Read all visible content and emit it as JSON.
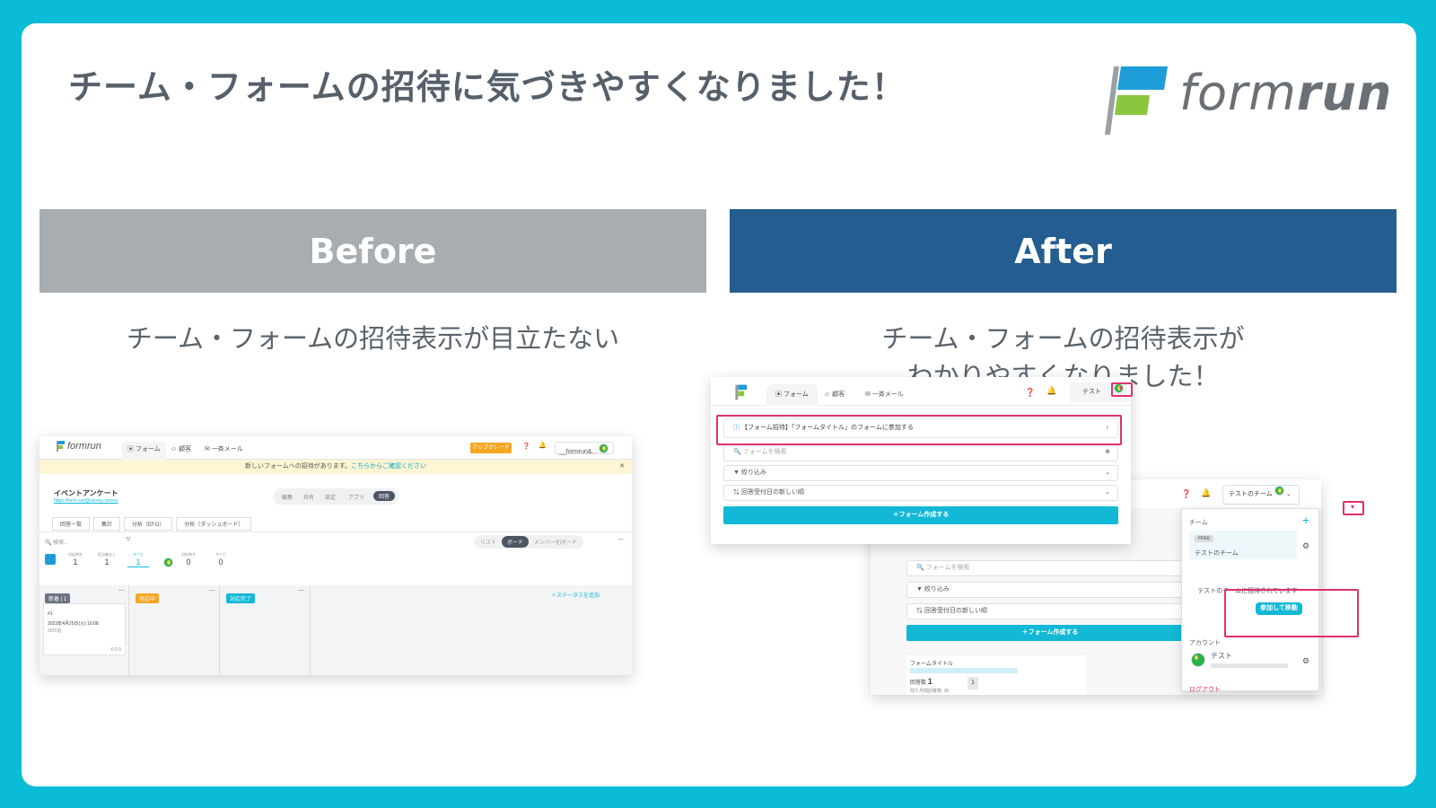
{
  "headline": "チーム・フォームの招待に気づきやすくなりました！",
  "brand": {
    "word_plain": "form",
    "word_bold": "run"
  },
  "before": {
    "banner": "Before",
    "caption": "チーム・フォームの招待表示が目立たない",
    "screenshot": {
      "logo": "formrun",
      "tabs": [
        "フォーム",
        "顧客",
        "一斉メール"
      ],
      "upgrade": "アップグレード",
      "account": "__formrun&...",
      "notice_text": "新しいフォームへの招待があります。",
      "notice_link": "こちらからご確認ください",
      "form_title": "イベントアンケート",
      "form_link": "https://form.run/@survey-xxxxxx",
      "segments": [
        "編集",
        "共有",
        "設定",
        "アプリ",
        "回答"
      ],
      "subtabs": [
        "回答一覧",
        "集計",
        "分析（EFO）",
        "分析（ダッシュボード）"
      ],
      "search_placeholder": "検索...",
      "view_toggle": [
        "リスト",
        "ボード",
        "メンバー別ボード"
      ],
      "counters": [
        {
          "label": "対応待ち",
          "value": "1"
        },
        {
          "label": "担当者なし",
          "value": "1"
        },
        {
          "label": "すべて",
          "value": "1"
        },
        {
          "label": "対応待ち",
          "value": "0"
        },
        {
          "label": "すべて",
          "value": "0"
        }
      ],
      "columns": [
        {
          "label": "新着",
          "count": "1",
          "color": "#6b7280"
        },
        {
          "label": "対応中",
          "count": "",
          "color": "#f5a623"
        },
        {
          "label": "対応完了",
          "count": "",
          "color": "#12b8d6"
        }
      ],
      "add_status": "＋ステータスを追加",
      "card": {
        "id": "#1",
        "date": "2023年4月25日(火) 16:08",
        "ago": "30日前",
        "meta": "0  0  0"
      }
    }
  },
  "after": {
    "banner": "After",
    "caption_line1": "チーム・フォームの招待表示が",
    "caption_line2": "わかりやすくなりました！",
    "top_window": {
      "tabs": [
        "フォーム",
        "顧客",
        "一斉メール"
      ],
      "account": "テスト",
      "invite_banner": "【フォーム招待】「フォームタイトル」のフォームに参加する",
      "search_placeholder": "フォームを検索",
      "filter": "絞り込み",
      "sort": "回答受付日の新しい順",
      "create": "＋フォーム作成する"
    },
    "back_window": {
      "account": "テストのチーム",
      "search_placeholder": "フォームを検索",
      "filter": "絞り込み",
      "sort": "回答受付日の新しい順",
      "create": "＋フォーム作成する",
      "form_label": "フォームタイトル",
      "responses_label": "回答数",
      "responses_value": "1",
      "remaining": "残り月間回答数: 30",
      "badge": "1"
    },
    "menu": {
      "team_header": "チーム",
      "plan_badge": "FREE",
      "team_name": "テストのチーム",
      "invite_text": "テストのチームに招待されています",
      "join_button": "参加して移動",
      "account_header": "アカウント",
      "account_name": "テスト",
      "logout": "ログアウト"
    }
  },
  "colors": {
    "frame": "#0bbcd6",
    "before_banner": "#a7adb1",
    "after_banner": "#245d8f",
    "highlight": "#e0306c",
    "accent": "#12b8d6"
  }
}
